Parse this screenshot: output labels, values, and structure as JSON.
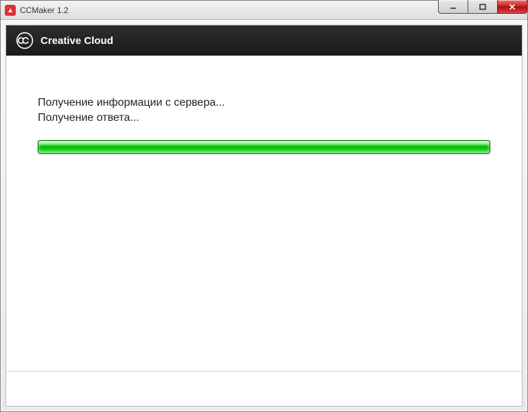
{
  "window": {
    "title": "CCMaker 1.2"
  },
  "header": {
    "product": "Creative Cloud"
  },
  "status": {
    "line1": "Получение информации с сервера...",
    "line2": "Получение ответа..."
  },
  "progress": {
    "percent": 100
  }
}
